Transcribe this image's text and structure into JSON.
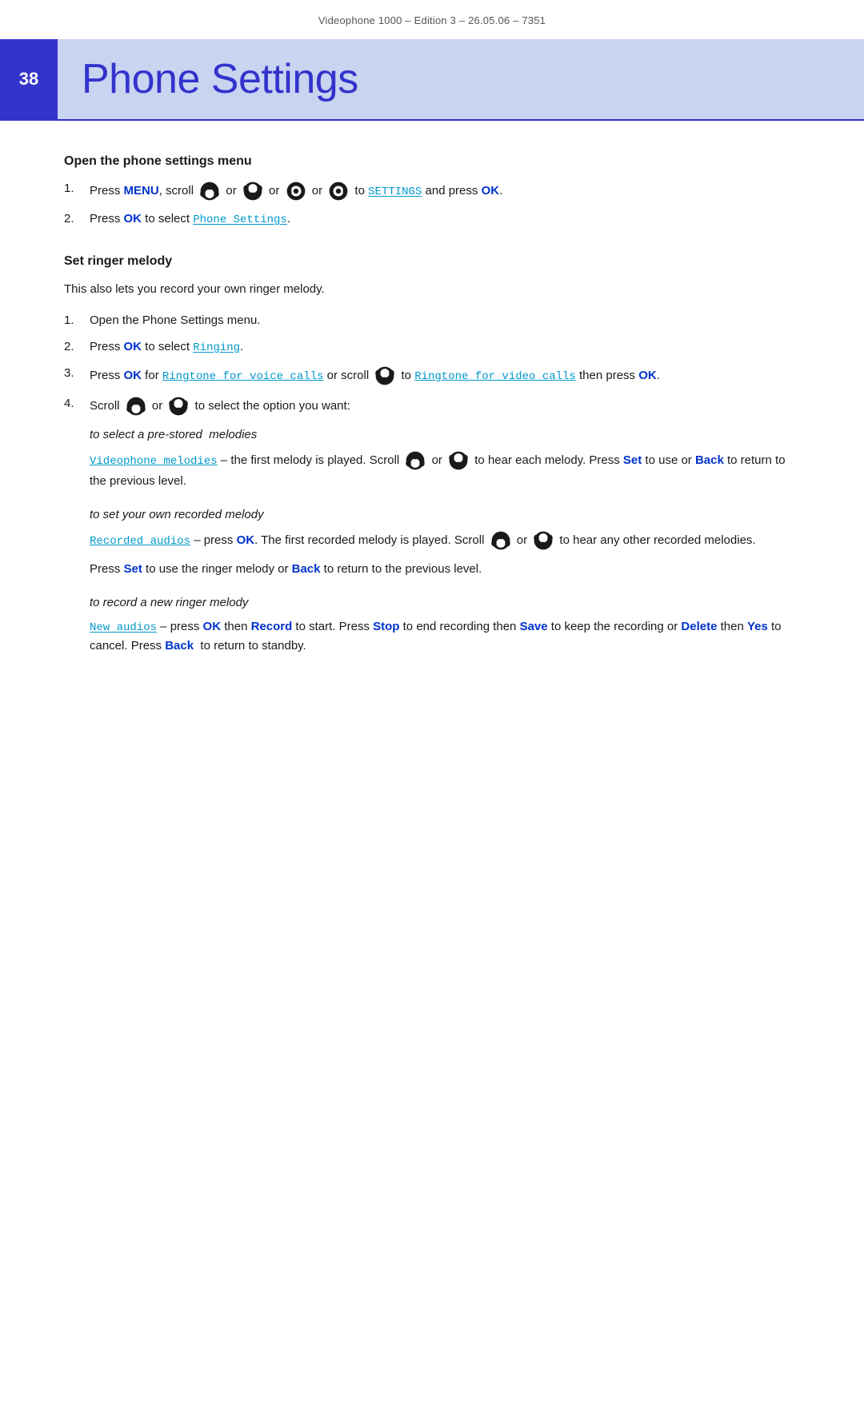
{
  "header": {
    "label": "Videophone 1000 – Edition 3 – 26.05.06 – 7351"
  },
  "page_number": "38",
  "page_title": "Phone Settings",
  "section1": {
    "heading": "Open the phone settings menu",
    "steps": [
      {
        "num": "1.",
        "parts": [
          {
            "type": "text",
            "value": "Press "
          },
          {
            "type": "blue-bold",
            "value": "MENU"
          },
          {
            "type": "text",
            "value": ", scroll "
          },
          {
            "type": "icon",
            "value": "scroll-up"
          },
          {
            "type": "text",
            "value": " or "
          },
          {
            "type": "icon",
            "value": "scroll-down"
          },
          {
            "type": "text",
            "value": " or "
          },
          {
            "type": "icon",
            "value": "nav-left"
          },
          {
            "type": "text",
            "value": " or "
          },
          {
            "type": "icon",
            "value": "nav-right"
          },
          {
            "type": "text",
            "value": " to "
          },
          {
            "type": "blue-mono",
            "value": "SETTINGS"
          },
          {
            "type": "text",
            "value": " and press "
          },
          {
            "type": "blue-bold",
            "value": "OK"
          },
          {
            "type": "text",
            "value": "."
          }
        ]
      },
      {
        "num": "2.",
        "parts": [
          {
            "type": "text",
            "value": "Press "
          },
          {
            "type": "blue-bold",
            "value": "OK"
          },
          {
            "type": "text",
            "value": " to select "
          },
          {
            "type": "blue-mono",
            "value": "Phone Settings"
          },
          {
            "type": "text",
            "value": "."
          }
        ]
      }
    ]
  },
  "section2": {
    "heading": "Set ringer melody",
    "intro": "This also lets you record your own ringer melody.",
    "steps": [
      {
        "num": "1.",
        "text": "Open the Phone Settings menu."
      },
      {
        "num": "2.",
        "parts": [
          {
            "type": "text",
            "value": "Press "
          },
          {
            "type": "blue-bold",
            "value": "OK"
          },
          {
            "type": "text",
            "value": " to select "
          },
          {
            "type": "blue-mono",
            "value": "Ringing"
          },
          {
            "type": "text",
            "value": "."
          }
        ]
      },
      {
        "num": "3.",
        "parts": [
          {
            "type": "text",
            "value": "Press "
          },
          {
            "type": "blue-bold",
            "value": "OK"
          },
          {
            "type": "text",
            "value": " for "
          },
          {
            "type": "blue-mono",
            "value": "Ringtone for voice calls"
          },
          {
            "type": "text",
            "value": " or scroll "
          },
          {
            "type": "icon",
            "value": "scroll-down"
          },
          {
            "type": "text",
            "value": " to "
          },
          {
            "type": "blue-mono",
            "value": "Ringtone for video calls"
          },
          {
            "type": "text",
            "value": " then press "
          },
          {
            "type": "blue-bold",
            "value": "OK"
          },
          {
            "type": "text",
            "value": "."
          }
        ]
      },
      {
        "num": "4.",
        "parts": [
          {
            "type": "text",
            "value": "Scroll "
          },
          {
            "type": "icon",
            "value": "scroll-up"
          },
          {
            "type": "text",
            "value": " or "
          },
          {
            "type": "icon",
            "value": "scroll-down"
          },
          {
            "type": "text",
            "value": " to select the option you want:"
          }
        ]
      }
    ],
    "sub_sections": [
      {
        "label": "to select a pre-stored  melodies",
        "paragraphs": [
          {
            "parts": [
              {
                "type": "blue-mono",
                "value": "Videophone melodies"
              },
              {
                "type": "text",
                "value": " – the first melody is played. Scroll "
              },
              {
                "type": "icon",
                "value": "scroll-up"
              },
              {
                "type": "text",
                "value": " or "
              },
              {
                "type": "icon",
                "value": "scroll-down"
              },
              {
                "type": "text",
                "value": " to hear each melody. Press "
              },
              {
                "type": "blue-bold",
                "value": "Set"
              },
              {
                "type": "text",
                "value": " to use or "
              },
              {
                "type": "blue-bold",
                "value": "Back"
              },
              {
                "type": "text",
                "value": " to return to the previous level."
              }
            ]
          }
        ]
      },
      {
        "label": "to set your own recorded melody",
        "paragraphs": [
          {
            "parts": [
              {
                "type": "blue-mono",
                "value": "Recorded audios"
              },
              {
                "type": "text",
                "value": " – press "
              },
              {
                "type": "blue-bold",
                "value": "OK"
              },
              {
                "type": "text",
                "value": ". The first recorded melody is played. Scroll "
              },
              {
                "type": "icon",
                "value": "scroll-up"
              },
              {
                "type": "text",
                "value": " or "
              },
              {
                "type": "icon",
                "value": "scroll-down"
              },
              {
                "type": "text",
                "value": " to hear any other recorded melodies."
              }
            ]
          },
          {
            "parts": [
              {
                "type": "text",
                "value": "Press "
              },
              {
                "type": "blue-bold",
                "value": "Set"
              },
              {
                "type": "text",
                "value": " to use the ringer melody or "
              },
              {
                "type": "blue-bold",
                "value": "Back"
              },
              {
                "type": "text",
                "value": " to return to the previous level."
              }
            ]
          }
        ]
      },
      {
        "label": "to record a new ringer melody",
        "paragraphs": [
          {
            "parts": [
              {
                "type": "blue-mono",
                "value": "New audios"
              },
              {
                "type": "text",
                "value": " – press "
              },
              {
                "type": "blue-bold",
                "value": "OK"
              },
              {
                "type": "text",
                "value": " then "
              },
              {
                "type": "blue-bold",
                "value": "Record"
              },
              {
                "type": "text",
                "value": " to start. Press "
              },
              {
                "type": "blue-bold",
                "value": "Stop"
              },
              {
                "type": "text",
                "value": " to end recording then "
              },
              {
                "type": "blue-bold",
                "value": "Save"
              },
              {
                "type": "text",
                "value": " to keep the recording or "
              },
              {
                "type": "blue-bold",
                "value": "Delete"
              },
              {
                "type": "text",
                "value": " then "
              },
              {
                "type": "blue-bold",
                "value": "Yes"
              },
              {
                "type": "text",
                "value": " to cancel. Press "
              },
              {
                "type": "blue-bold",
                "value": "Back"
              },
              {
                "type": "text",
                "value": "  to return to standby."
              }
            ]
          }
        ]
      }
    ]
  }
}
